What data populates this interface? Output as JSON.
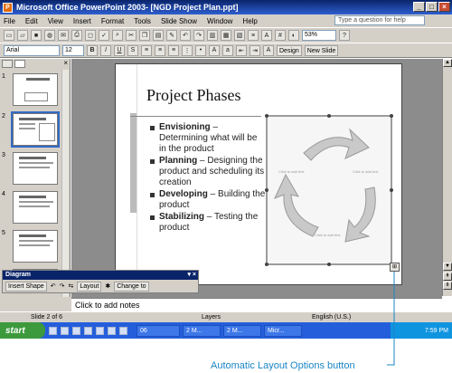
{
  "window": {
    "title": "Microsoft Office PowerPoint 2003- [NGD Project Plan.ppt]"
  },
  "menu": [
    "File",
    "Edit",
    "View",
    "Insert",
    "Format",
    "Tools",
    "Slide Show",
    "Window",
    "Help"
  ],
  "help_box": {
    "placeholder": "Type a question for help"
  },
  "toolbar": {
    "font": "Arial",
    "size": "12",
    "zoom": "53%",
    "design_label": "Design",
    "new_slide_label": "New Slide"
  },
  "thumbnails": [
    "1",
    "2",
    "3",
    "4",
    "5",
    "6"
  ],
  "slide": {
    "title": "Project Phases",
    "bullets": [
      {
        "bold": "Envisioning",
        "rest": " – Determining what will be in the product"
      },
      {
        "bold": "Planning",
        "rest": " – Designing the product and scheduling its creation"
      },
      {
        "bold": "Developing",
        "rest": " – Building the product"
      },
      {
        "bold": "Stabilizing",
        "rest": " – Testing the product"
      }
    ],
    "diagram_text": [
      "Click to add text",
      "Click to add text",
      "Click to add text"
    ]
  },
  "diagram_toolbar": {
    "title": "Diagram",
    "insert_shape": "Insert Shape",
    "layout": "Layout",
    "change_to": "Change to"
  },
  "notes_placeholder": "Click to add notes",
  "status": {
    "slide": "Slide 2 of 6",
    "design": "Layers",
    "language": "English (U.S.)"
  },
  "taskbar": {
    "start": "start",
    "items": [
      "06",
      "2 M...",
      "2 M...",
      "Micr..."
    ],
    "clock": "7:59 PM"
  },
  "callout": "Automatic Layout Options button",
  "colors": {
    "title_bar": "#0a246a",
    "taskbar": "#245edb",
    "callout": "#1a86c6"
  }
}
